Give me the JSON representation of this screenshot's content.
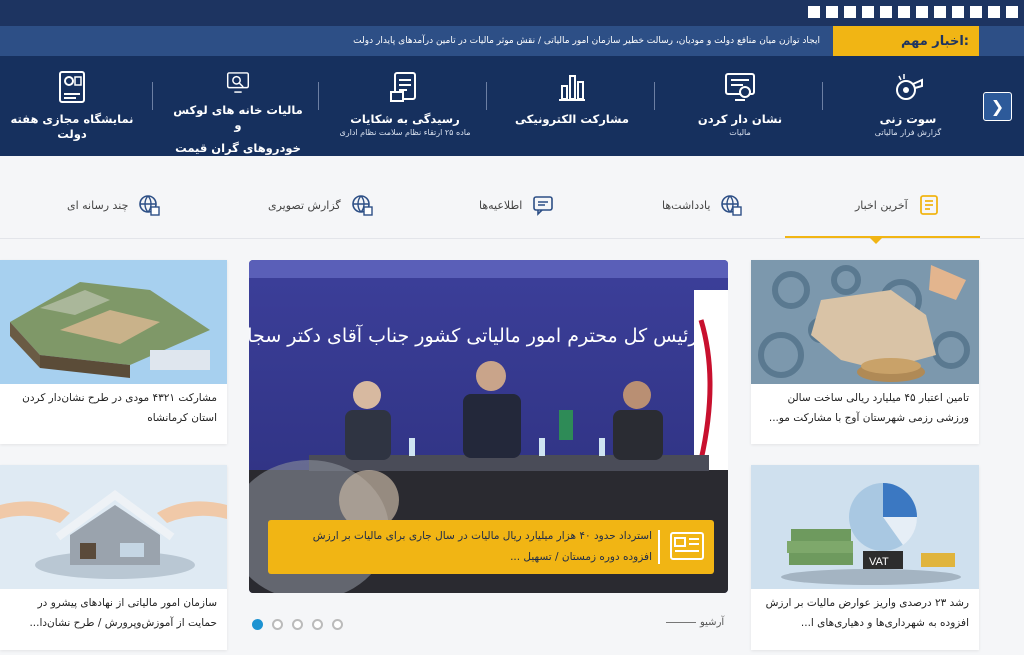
{
  "ticker": {
    "label": "اخبار مهم:",
    "text": "ایجاد توازن میان منافع دولت و مودیان، رسالت خطیر سازمان امور مالیاتی / نقش موثر مالیات در تامین درآمدهای پایدار دولت"
  },
  "services": [
    {
      "title": "سوت زنی",
      "subtitle": "گزارش فرار مالیاتی",
      "icon": "whistle-icon"
    },
    {
      "title": "نشان دار کردن",
      "subtitle": "مالیات",
      "icon": "monitor-icon"
    },
    {
      "title": "مشارکت الکترونیکی",
      "subtitle": "",
      "icon": "chart-icon"
    },
    {
      "title": "رسیدگی به شکایات",
      "subtitle": "ماده ۲۵ ارتقاء نظام سلامت نظام اداری",
      "icon": "complaint-icon"
    },
    {
      "title": "مالیات خانه های لوکس و",
      "subtitle": "خودروهای گران قیمت",
      "icon": "search-monitor-icon"
    },
    {
      "title": "نمایشگاه مجازی هفته دولت",
      "subtitle": "",
      "icon": "exhibition-icon"
    }
  ],
  "tabs": [
    {
      "label": "آخرین اخبار",
      "icon": "news-icon",
      "active": true
    },
    {
      "label": "یادداشت‌ها",
      "icon": "globe-icon"
    },
    {
      "label": "اطلاعیه‌ها",
      "icon": "chat-icon"
    },
    {
      "label": "گزارش تصویری",
      "icon": "globe-icon"
    },
    {
      "label": "چند رسانه ای",
      "icon": "globe-icon"
    }
  ],
  "cards": {
    "right_top": "تامین اعتبار ۴۵ میلیارد ریالی ساخت سالن ورزشی رزمی شهرستان آوج با مشارکت مو...",
    "right_bottom": "رشد ۲۳ درصدی واریز عوارض مالیات بر ارزش افزوده به شهرداری‌ها و دهیاری‌های ا...",
    "left_top": "مشارکت ۴۳۲۱ مودی در طرح نشان‌دار کردن استان کرمانشاه",
    "left_bottom": "سازمان امور مالیاتی از نهادهای پیشرو در حمایت از آموزش‌وپرورش / طرح نشان‌دا..."
  },
  "slider": {
    "caption": "استرداد حدود ۴۰ هزار میلیارد ریال مالیات در سال جاری برای مالیات بر ارزش افزوده دوره زمستان / تسهیل ...",
    "banner_text": "نشست رئیس کل محترم امور مالیاتی کشور جناب آقای دکتر سجانیان",
    "dots": 5,
    "active_dot": 0
  },
  "archive_label": "آرشیو",
  "colors": {
    "navy": "#16305e",
    "ticker": "#2d4f86",
    "accent": "#f1b514",
    "dot_active": "#1d93d2"
  }
}
